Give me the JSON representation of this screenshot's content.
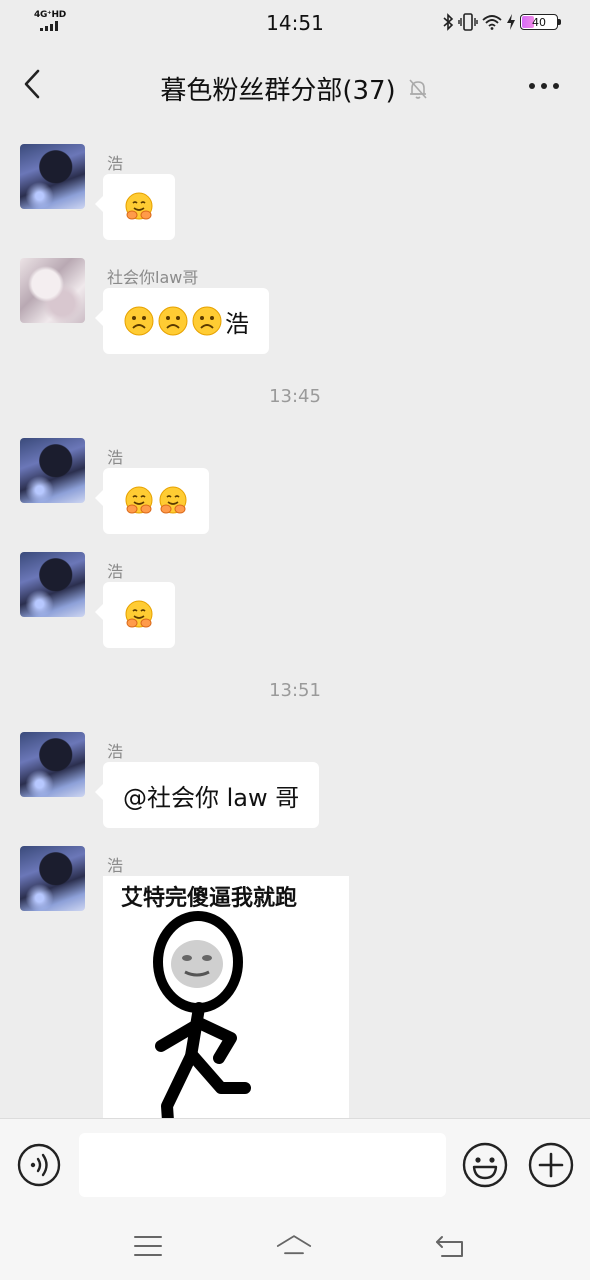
{
  "status_bar": {
    "network": "4G⁺HD",
    "time": "14:51",
    "battery": "40",
    "battery_level": 0.4
  },
  "header": {
    "title": "暮色粉丝群分部(37)",
    "back_icon": "chevron-left-icon",
    "mute_icon": "bell-off-icon",
    "more_icon": "more-horizontal-icon"
  },
  "messages": [
    {
      "type": "msg",
      "sender": "浩",
      "avatar": "avatar-a",
      "emojis": 1,
      "text": ""
    },
    {
      "type": "msg",
      "sender": "社会你law哥",
      "avatar": "avatar-b",
      "emojis": 3,
      "text": "浩"
    },
    {
      "type": "time",
      "text": "13:45"
    },
    {
      "type": "msg",
      "sender": "浩",
      "avatar": "avatar-a",
      "emojis": 2,
      "text": ""
    },
    {
      "type": "msg",
      "sender": "浩",
      "avatar": "avatar-a",
      "emojis": 1,
      "text": ""
    },
    {
      "type": "time",
      "text": "13:51"
    },
    {
      "type": "msg",
      "sender": "浩",
      "avatar": "avatar-a",
      "emojis": 0,
      "text": "@社会你 law 哥"
    },
    {
      "type": "sticker",
      "sender": "浩",
      "avatar": "avatar-a",
      "caption": "艾特完傻逼我就跑"
    }
  ],
  "input": {
    "value": "",
    "placeholder": "",
    "voice_icon": "voice-icon",
    "emoji_icon": "smile-icon",
    "plus_icon": "plus-circle-icon"
  },
  "nav": {
    "menu_icon": "menu-icon",
    "home_icon": "home-icon",
    "back_icon": "return-icon"
  },
  "colors": {
    "background": "#ededed",
    "bubble": "#ffffff",
    "sender": "#8a8a8a",
    "timestamp": "#9a9a9a",
    "battery_fill": "#d66bf7"
  }
}
